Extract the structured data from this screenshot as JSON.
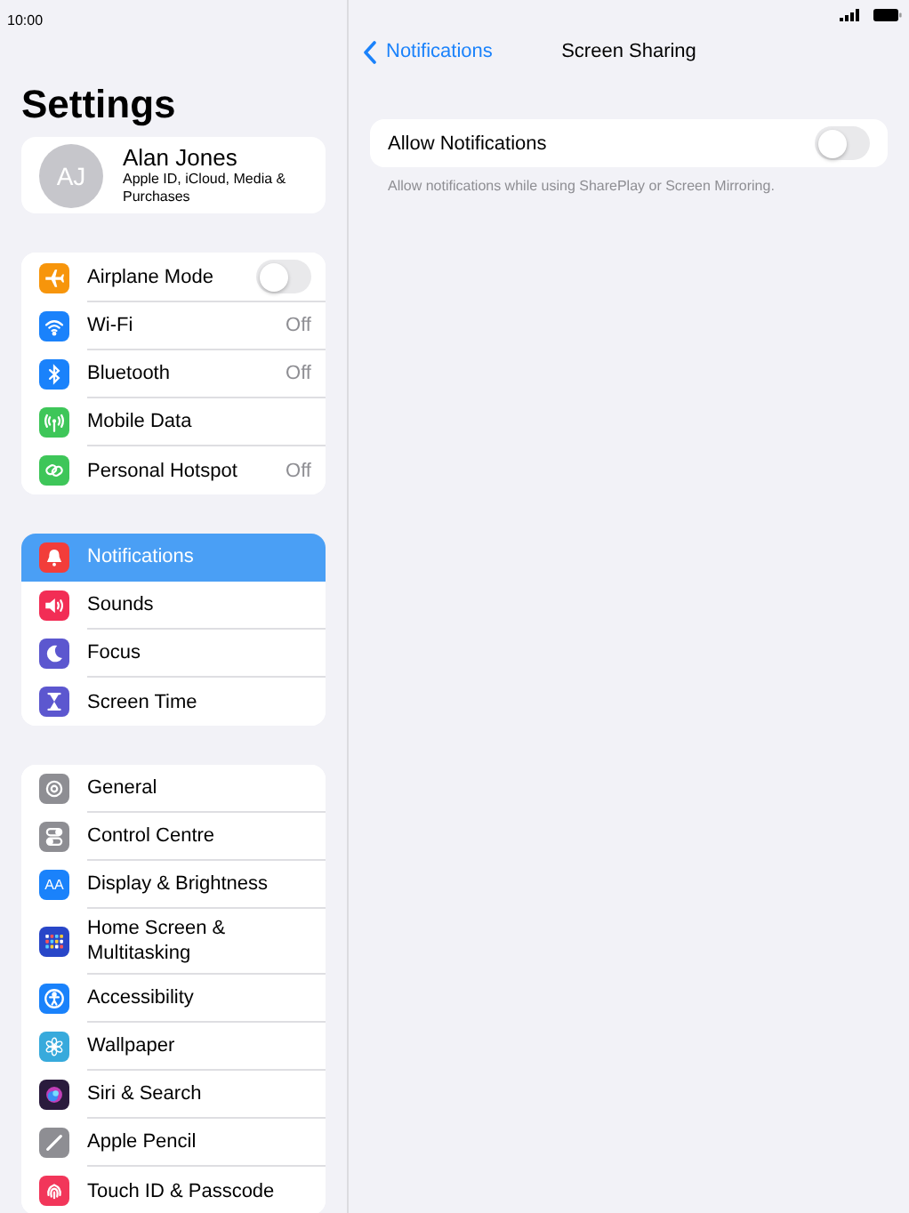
{
  "status_bar": {
    "time": "10:00"
  },
  "sidebar": {
    "title": "Settings",
    "profile": {
      "initials": "AJ",
      "name": "Alan Jones",
      "subtitle": "Apple ID, iCloud, Media & Purchases"
    },
    "groups": [
      {
        "items": [
          {
            "label": "Airplane Mode",
            "kind": "toggle",
            "on": false,
            "selected": false,
            "color": "#f7950b"
          },
          {
            "label": "Wi-Fi",
            "kind": "value",
            "value": "Off",
            "selected": false,
            "color": "#1a82fb"
          },
          {
            "label": "Bluetooth",
            "kind": "value",
            "value": "Off",
            "selected": false,
            "color": "#1a82fb"
          },
          {
            "label": "Mobile Data",
            "kind": "plain",
            "selected": false,
            "color": "#3ec659"
          },
          {
            "label": "Personal Hotspot",
            "kind": "value",
            "value": "Off",
            "selected": false,
            "color": "#3ec659"
          }
        ]
      },
      {
        "items": [
          {
            "label": "Notifications",
            "kind": "plain",
            "selected": true,
            "color": "#f23d3a"
          },
          {
            "label": "Sounds",
            "kind": "plain",
            "selected": false,
            "color": "#f22d55"
          },
          {
            "label": "Focus",
            "kind": "plain",
            "selected": false,
            "color": "#5c57cf"
          },
          {
            "label": "Screen Time",
            "kind": "plain",
            "selected": false,
            "color": "#5c57cf"
          }
        ]
      },
      {
        "items": [
          {
            "label": "General",
            "kind": "plain",
            "selected": false,
            "color": "#8e8e93"
          },
          {
            "label": "Control Centre",
            "kind": "plain",
            "selected": false,
            "color": "#8e8e93"
          },
          {
            "label": "Display & Brightness",
            "kind": "plain",
            "selected": false,
            "color": "#1a82fb",
            "icon_text": "AA"
          },
          {
            "label": "Home Screen & Multitasking",
            "kind": "plain",
            "selected": false,
            "color": "#2846c8"
          },
          {
            "label": "Accessibility",
            "kind": "plain",
            "selected": false,
            "color": "#1a82fb"
          },
          {
            "label": "Wallpaper",
            "kind": "plain",
            "selected": false,
            "color": "#37aadc"
          },
          {
            "label": "Siri & Search",
            "kind": "plain",
            "selected": false,
            "color": "#2a1b3d"
          },
          {
            "label": "Apple Pencil",
            "kind": "plain",
            "selected": false,
            "color": "#8e8e93"
          },
          {
            "label": "Touch ID & Passcode",
            "kind": "plain",
            "selected": false,
            "color": "#f2365a"
          }
        ]
      }
    ]
  },
  "detail": {
    "back": "Notifications",
    "title": "Screen Sharing",
    "rows": [
      {
        "label": "Allow Notifications",
        "kind": "toggle",
        "on": false
      }
    ],
    "footer": "Allow notifications while using SharePlay or Screen Mirroring."
  }
}
